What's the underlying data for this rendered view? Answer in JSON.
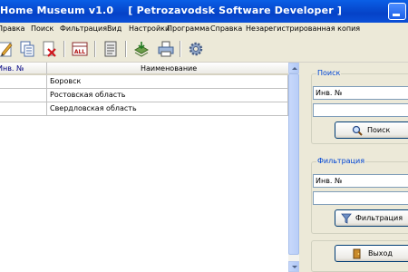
{
  "window": {
    "title": "Home Museum v1.0    [ Petrozavodsk Software Developer ]"
  },
  "menu": [
    {
      "label": "Правка"
    },
    {
      "label": "Поиск"
    },
    {
      "label": "Фильтрация"
    },
    {
      "label": "Вид"
    },
    {
      "label": "Настройки"
    },
    {
      "label": "Программа"
    },
    {
      "label": "Справка"
    },
    {
      "label": "Незарегистрированная копия"
    }
  ],
  "toolbar": {
    "icons": [
      "edit-icon",
      "copy-icon",
      "delete-icon",
      "all-records-icon",
      "document-icon",
      "export-icon",
      "print-icon",
      "settings-gear-icon"
    ],
    "all_label": "ALL"
  },
  "table": {
    "columns": [
      "Инв. №",
      "Наименование"
    ],
    "rows": [
      {
        "inv": "",
        "name": "Боровск"
      },
      {
        "inv": "",
        "name": "Ростовская область"
      },
      {
        "inv": "",
        "name": "Свердловская область"
      }
    ]
  },
  "search": {
    "group_label": "Поиск",
    "field_selected": "Инв. №",
    "value": "",
    "button_label": "Поиск"
  },
  "filter": {
    "group_label": "Фильтрация",
    "field_selected": "Инв. №",
    "value": "",
    "button_label": "Фильтрация"
  },
  "exit": {
    "button_label": "Выход"
  },
  "colors": {
    "titlebar": "#0A5FE6",
    "group_label": "#0046D5",
    "window_bg": "#ECE9D8"
  }
}
